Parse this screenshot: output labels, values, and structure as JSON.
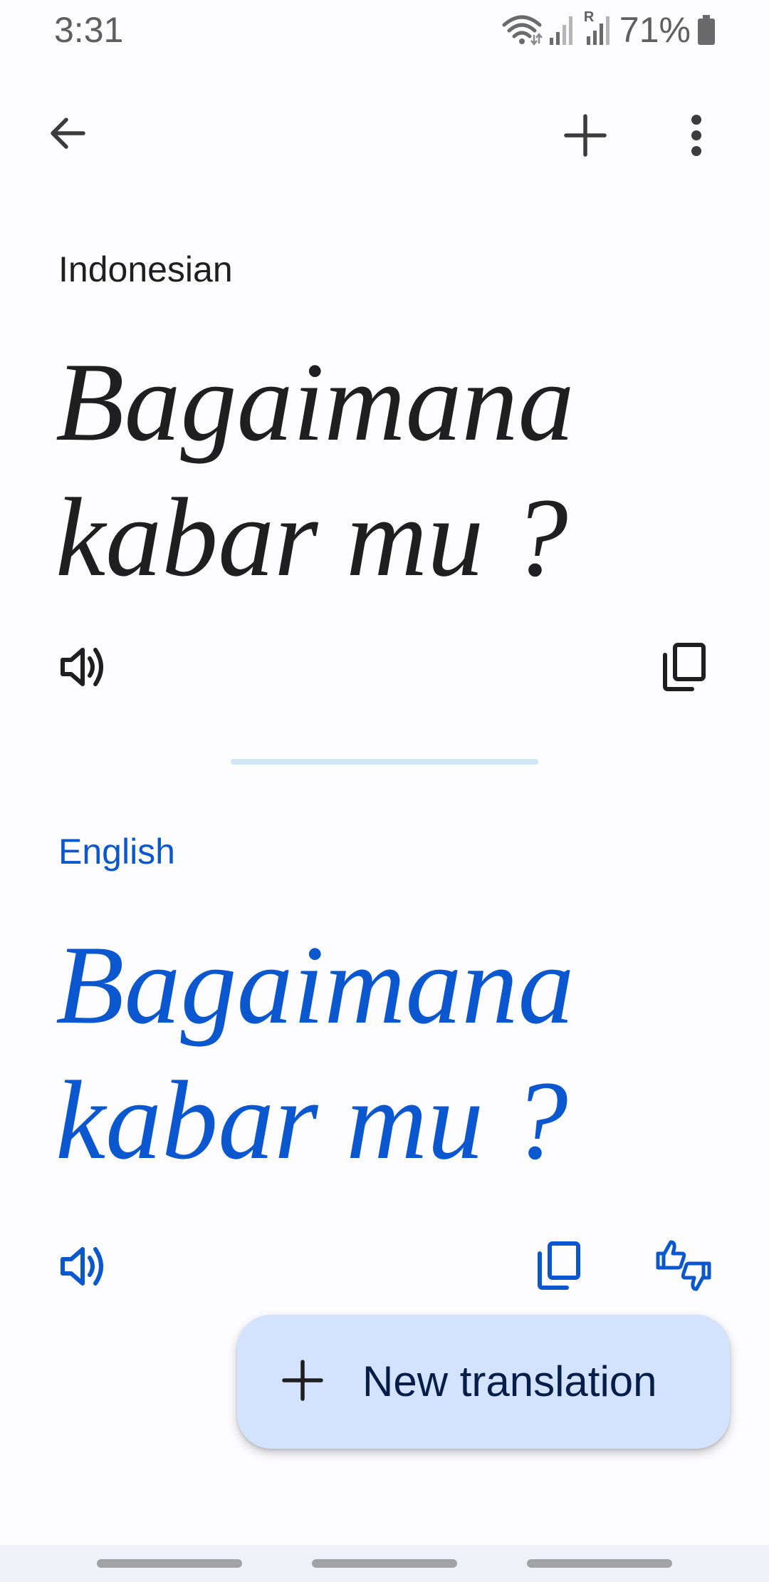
{
  "status_bar": {
    "time": "3:31",
    "battery": "71%",
    "signal_roaming_label": "R",
    "icons": [
      "wifi-icon",
      "signal-icon",
      "signal-roaming-icon",
      "battery-icon"
    ]
  },
  "app_bar": {
    "back_icon": "arrow-back-icon",
    "add_icon": "plus-icon",
    "more_icon": "more-vert-icon"
  },
  "source": {
    "language": "Indonesian",
    "text": "Bagaimana kabar mu ?",
    "speak_icon": "volume-icon",
    "copy_icon": "copy-icon"
  },
  "target": {
    "language": "English",
    "text": "Bagaimana kabar mu ?",
    "speak_icon": "volume-icon",
    "copy_icon": "copy-icon",
    "feedback_icon": "thumbs-up-down-icon"
  },
  "fab": {
    "label": "New translation",
    "icon": "plus-icon"
  },
  "colors": {
    "accent": "#0b57d0",
    "text": "#1f1f1f",
    "fab_background": "#d3e3fd",
    "fab_text": "#041e49",
    "background": "#fdfcff"
  }
}
